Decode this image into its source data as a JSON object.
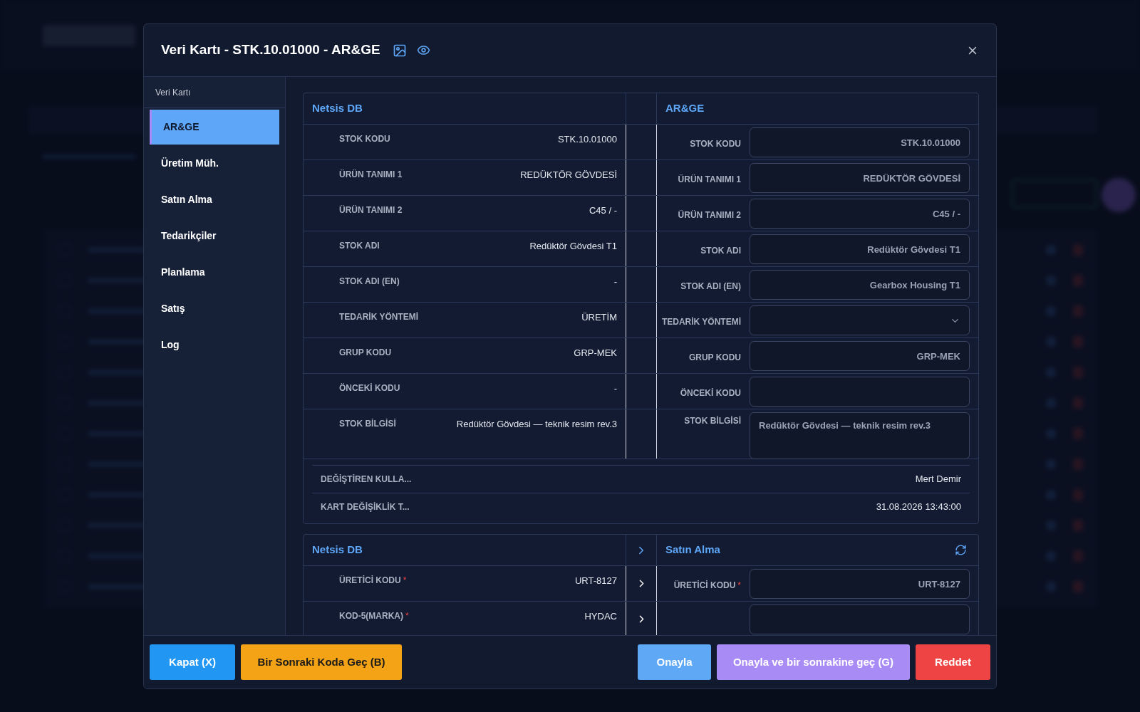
{
  "modal": {
    "title": "Veri Kartı - STK.10.01000 - AR&GE"
  },
  "sidebar": {
    "header": "Veri Kartı",
    "items": [
      {
        "label": "AR&GE",
        "selected": true
      },
      {
        "label": "Üretim Müh.",
        "selected": false
      },
      {
        "label": "Satın Alma",
        "selected": false
      },
      {
        "label": "Tedarikçiler",
        "selected": false
      },
      {
        "label": "Planlama",
        "selected": false
      },
      {
        "label": "Satış",
        "selected": false
      },
      {
        "label": "Log",
        "selected": false
      }
    ]
  },
  "sections": [
    {
      "left_title": "Netsis DB",
      "right_title": "AR&GE",
      "transfer": false,
      "refresh": false,
      "rows": [
        {
          "source": {
            "label": "STOK KODU",
            "value": "STK.10.01000"
          },
          "target": {
            "label": "STOK KODU",
            "kind": "text",
            "value": "STK.10.01000"
          }
        },
        {
          "source": {
            "label": "ÜRÜN TANIMI 1",
            "value": "REDÜKTÖR GÖVDESİ"
          },
          "target": {
            "label": "ÜRÜN TANIMI 1",
            "kind": "text",
            "value": "REDÜKTÖR GÖVDESİ"
          }
        },
        {
          "source": {
            "label": "ÜRÜN TANIMI 2",
            "value": "C45 / -"
          },
          "target": {
            "label": "ÜRÜN TANIMI 2",
            "kind": "text",
            "value": "C45 / -"
          }
        },
        {
          "source": {
            "label": "STOK ADI",
            "value": "Redüktör Gövdesi T1"
          },
          "target": {
            "label": "STOK ADI",
            "kind": "text",
            "value": "Redüktör Gövdesi T1"
          }
        },
        {
          "source": {
            "label": "STOK ADI (EN)",
            "value": "-"
          },
          "target": {
            "label": "STOK ADI (EN)",
            "kind": "text",
            "value": "Gearbox Housing T1"
          }
        },
        {
          "source": {
            "label": "TEDARİK YÖNTEMİ",
            "value": "ÜRETİM"
          },
          "target": {
            "label": "TEDARİK YÖNTEMİ",
            "kind": "select"
          }
        },
        {
          "source": {
            "label": "GRUP KODU",
            "value": "GRP-MEK"
          },
          "target": {
            "label": "GRUP KODU",
            "kind": "text",
            "value": "GRP-MEK"
          }
        },
        {
          "source": {
            "label": "ÖNCEKİ KODU",
            "value": "-"
          },
          "target": {
            "label": "ÖNCEKİ KODU",
            "kind": "text"
          }
        },
        {
          "source": {
            "label": "STOK BİLGİSİ",
            "value": "Redüktör Gövdesi — teknik resim rev.3"
          },
          "target": {
            "label": "STOK BİLGİSİ",
            "kind": "textarea",
            "value": "Redüktör Gövdesi — teknik resim rev.3"
          }
        }
      ],
      "audit": [
        {
          "label": "DEĞİŞTİREN KULLA...",
          "value": "Mert Demir"
        },
        {
          "label": "KART DEĞİŞİKLİK T...",
          "value": "31.08.2026 13:43:00"
        }
      ]
    },
    {
      "left_title": "Netsis DB",
      "right_title": "Satın Alma",
      "transfer": true,
      "refresh": true,
      "rows": [
        {
          "source": {
            "label": "ÜRETİCİ KODU",
            "mark": "*",
            "value": "URT-8127"
          },
          "target": {
            "label": "ÜRETİCİ KODU",
            "mark": "*",
            "kind": "text",
            "value": "URT-8127"
          }
        },
        {
          "source": {
            "label": "KOD-5(MARKA)",
            "mark": "*",
            "value": "HYDAC"
          },
          "target": {
            "kind": "text"
          }
        }
      ]
    }
  ],
  "footer": {
    "buttons": [
      {
        "label": "Kapat (X)",
        "kind": "close"
      },
      {
        "label": "Bir Sonraki Koda Geç (B)",
        "kind": "next"
      },
      {
        "label": "Onayla",
        "kind": "approve"
      },
      {
        "label": "Onayla ve bir sonrakine geç (G)",
        "kind": "approve_next"
      },
      {
        "label": "Reddet",
        "kind": "reject"
      }
    ]
  }
}
